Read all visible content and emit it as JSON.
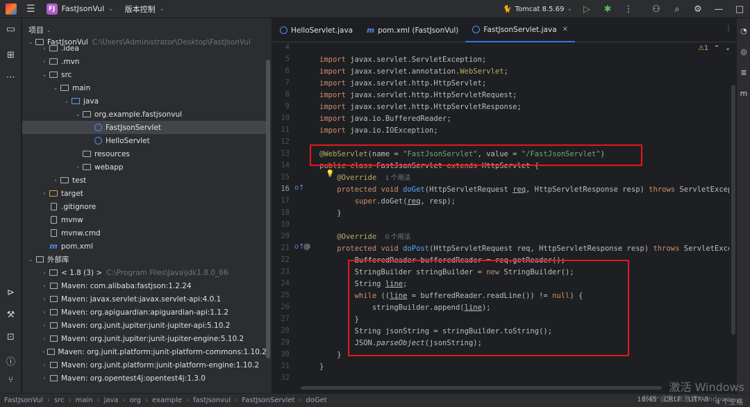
{
  "titlebar": {
    "project_badge": "FJ",
    "project_name": "FastJsonVul",
    "vcs_label": "版本控制",
    "run_config": "Tomcat 8.5.69"
  },
  "project_panel": {
    "title": "项目",
    "tree": [
      {
        "label": "FastJsonVul",
        "extra": "C:\\Users\\Administrator\\Desktop\\FastJsonVul",
        "icon": "folder"
      },
      {
        "label": ".idea",
        "icon": "folder"
      },
      {
        "label": ".mvn",
        "icon": "folder"
      },
      {
        "label": "src",
        "icon": "folder"
      },
      {
        "label": "main",
        "icon": "folder"
      },
      {
        "label": "java",
        "icon": "folder-blue"
      },
      {
        "label": "org.example.fastjsonvul",
        "icon": "package"
      },
      {
        "label": "FastJsonServlet",
        "icon": "class",
        "selected": true
      },
      {
        "label": "HelloServlet",
        "icon": "class"
      },
      {
        "label": "resources",
        "icon": "folder"
      },
      {
        "label": "webapp",
        "icon": "folder"
      },
      {
        "label": "test",
        "icon": "folder"
      },
      {
        "label": "target",
        "icon": "folder-orange"
      },
      {
        "label": ".gitignore",
        "icon": "file"
      },
      {
        "label": "mvnw",
        "icon": "file"
      },
      {
        "label": "mvnw.cmd",
        "icon": "file"
      },
      {
        "label": "pom.xml",
        "icon": "maven"
      },
      {
        "label": "外部库",
        "icon": "library"
      },
      {
        "label": "< 1.8 (3) >",
        "extra": "C:\\Program Files\\Java\\jdk1.8.0_66",
        "icon": "folder"
      },
      {
        "label": "Maven: com.alibaba:fastjson:1.2.24",
        "icon": "library"
      },
      {
        "label": "Maven: javax.servlet:javax.servlet-api:4.0.1",
        "icon": "library"
      },
      {
        "label": "Maven: org.apiguardian:apiguardian-api:1.1.2",
        "icon": "library"
      },
      {
        "label": "Maven: org.junit.jupiter:junit-jupiter-api:5.10.2",
        "icon": "library"
      },
      {
        "label": "Maven: org.junit.jupiter:junit-jupiter-engine:5.10.2",
        "icon": "library"
      },
      {
        "label": "Maven: org.junit.platform:junit-platform-commons:1.10.2",
        "icon": "library"
      },
      {
        "label": "Maven: org.junit.platform:junit-platform-engine:1.10.2",
        "icon": "library"
      },
      {
        "label": "Maven: org.opentest4j:opentest4j:1.3.0",
        "icon": "library"
      }
    ]
  },
  "editor": {
    "tabs": [
      {
        "label": "HelloServlet.java",
        "icon": "class"
      },
      {
        "label": "pom.xml (FastJsonVul)",
        "icon": "maven"
      },
      {
        "label": "FastJsonServlet.java",
        "icon": "class",
        "active": true
      }
    ],
    "warnings": "1",
    "line_numbers": [
      "4",
      "5",
      "6",
      "7",
      "8",
      "9",
      "10",
      "11",
      "12",
      "13",
      "14",
      "15",
      "16",
      "17",
      "18",
      "19",
      "20",
      "21",
      "22",
      "23",
      "24",
      "25",
      "26",
      "27",
      "28",
      "29",
      "30",
      "31",
      "32"
    ],
    "current_line": "16",
    "usage_hint_1": "1 个用法",
    "usage_hint_0": "0 个用法"
  },
  "statusbar": {
    "breadcrumb": [
      "FastJsonVul",
      "src",
      "main",
      "java",
      "org",
      "example",
      "fastjsonvul",
      "FastJsonServlet",
      "doGet"
    ],
    "time": "16:45",
    "line_sep": "CRLF",
    "encoding": "UTF-8",
    "indent": "4 个空格"
  },
  "watermark": {
    "line1": "激活 Windows",
    "line2": "转到\"设置\"以激活 Windows。"
  }
}
